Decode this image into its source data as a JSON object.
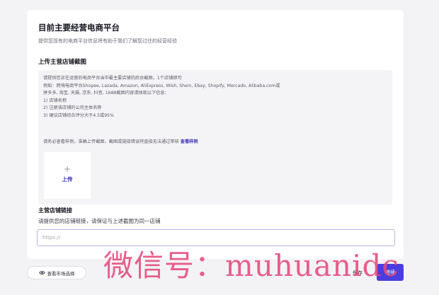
{
  "header": {
    "title": "目前主要经营电商平台",
    "subtitle": "提供您现有的电商平台信息将有助于我们了解您过往的经营经验"
  },
  "screenshot_section": {
    "title": "上传主营店铺截图",
    "instructions": [
      "请提供您正在运营的电商平台当中最主要店铺的后台截图，1个店铺即可",
      "例如：跨境电商平台Shopee, Lazada, Amazon, AliExpress, Wish, Shein, Ebay, Shopify, Mercado, Alibaba.com或",
      "拼多多, 淘宝, 天猫, 京东, 抖音, 1688截图内容请体现以下信息：",
      "1) 店铺名称",
      "2) 注册该店铺的公司主体名称",
      "3) 硬议店铺综合评分大于4.5或95%"
    ],
    "note": "请务必查看样例，准确上传截图，截图或链接错误将直接无法通过审核",
    "sample_link": "查看样例",
    "upload": {
      "plus": "+",
      "label": "上传"
    }
  },
  "link_section": {
    "title": "主营店铺链接",
    "description": "请提供您的店铺链接，请保证与上述截图为同一店铺",
    "input_value": "",
    "placeholder": "https://"
  },
  "footer": {
    "market_button": "查看市场选择",
    "save_button": "保存",
    "next_button": "继续"
  },
  "watermark": "微信号：muhuanidc",
  "colors": {
    "accent": "#4b3de0",
    "link": "#3a2fb8",
    "watermark": "#e54a7a",
    "page_background": "#f3f3f6"
  },
  "icons": {
    "market_button_icon": "eye-icon"
  }
}
